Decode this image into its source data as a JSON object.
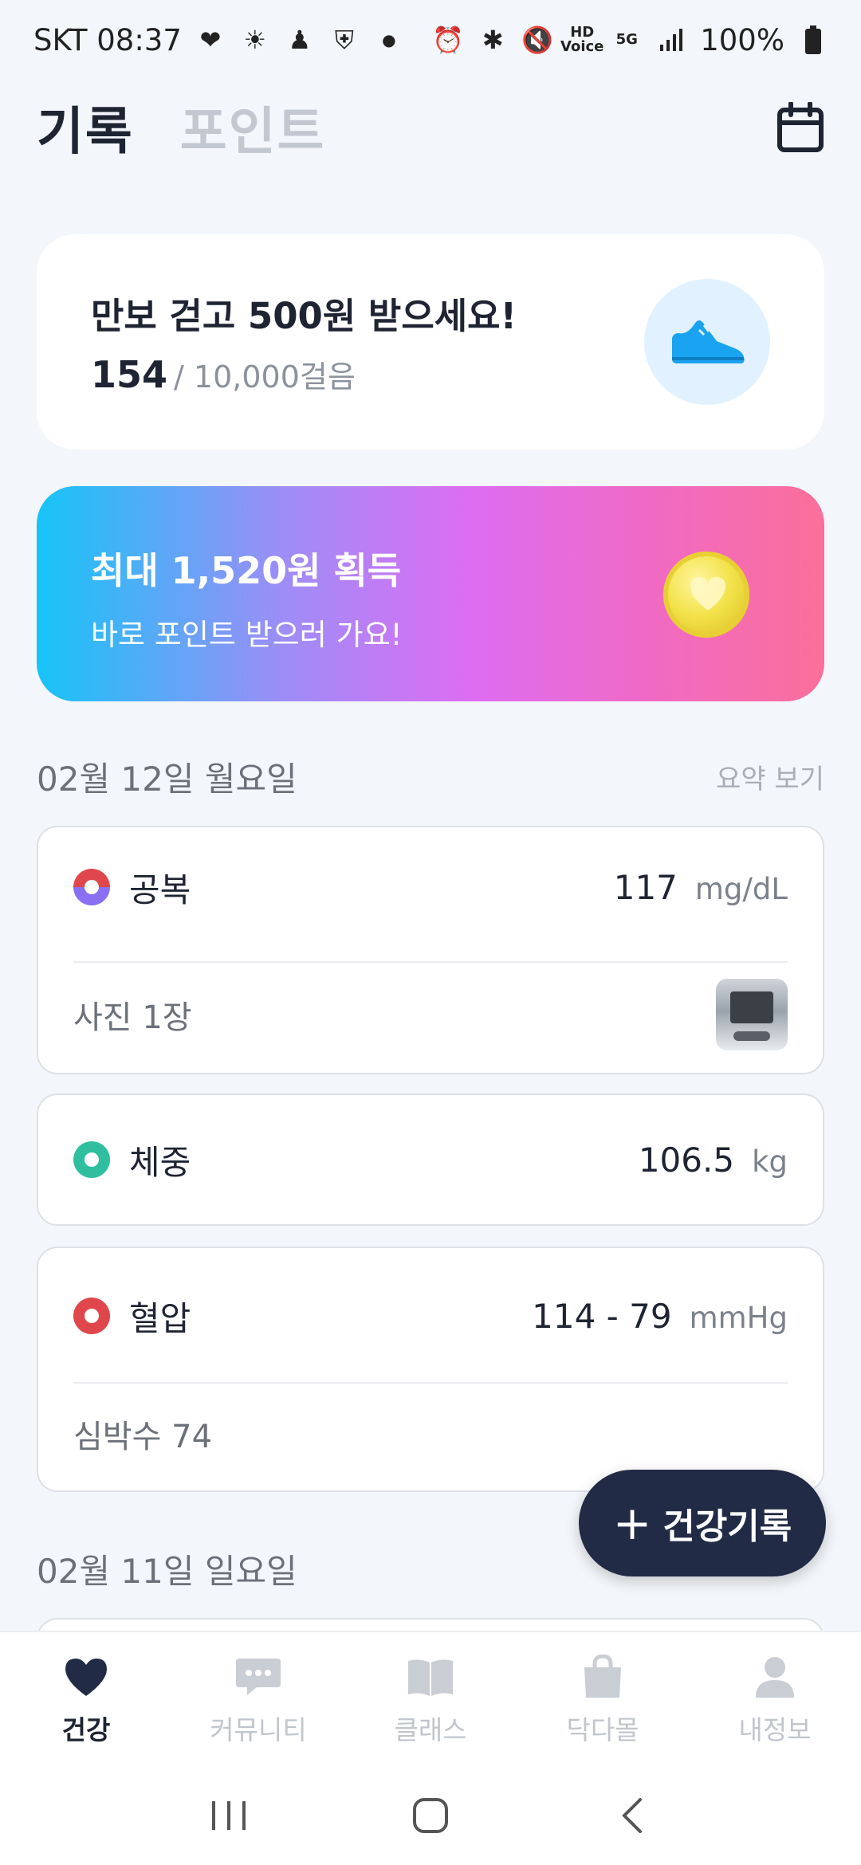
{
  "status_bar": {
    "carrier_time": "SKT 08:37",
    "battery": "100%",
    "hd_voice": "HD\nVoice",
    "network": "5G"
  },
  "header": {
    "tab_record": "기록",
    "tab_point": "포인트"
  },
  "steps_card": {
    "title": "만보 걷고 500원 받으세요!",
    "current": "154",
    "total": "/ 10,000걸음"
  },
  "point_banner": {
    "title": "최대 1,520원 획득",
    "subtitle": "바로 포인트 받으러 가요!"
  },
  "day1": {
    "date": "02월 12일 월요일",
    "summary": "요약 보기",
    "records": [
      {
        "label": "공복",
        "value": "117",
        "unit": "mg/dL",
        "sub": "사진 1장",
        "dot_color": "#e0474c",
        "dot_color2": "#8a6ff2"
      },
      {
        "label": "체중",
        "value": "106.5",
        "unit": "kg",
        "dot_color": "#2fbf9f"
      },
      {
        "label": "혈압",
        "value": "114 - 79",
        "unit": "mmHg",
        "sub": "심박수 74",
        "dot_color": "#e0474c"
      }
    ]
  },
  "day2": {
    "date": "02월 11일 일요일"
  },
  "fab": {
    "label": "건강기록"
  },
  "bottom_nav": [
    {
      "label": "건강",
      "icon": "heart-icon",
      "active": true
    },
    {
      "label": "커뮤니티",
      "icon": "chat-bubble-icon",
      "active": false
    },
    {
      "label": "클래스",
      "icon": "book-icon",
      "active": false
    },
    {
      "label": "닥다몰",
      "icon": "shopping-bag-icon",
      "active": false
    },
    {
      "label": "내정보",
      "icon": "person-icon",
      "active": false
    }
  ],
  "colors": {
    "primary_dark": "#222b45",
    "banner_start": "#16c4f7",
    "banner_end": "#fb6f9a",
    "shoe_blue": "#1aa3f0"
  }
}
